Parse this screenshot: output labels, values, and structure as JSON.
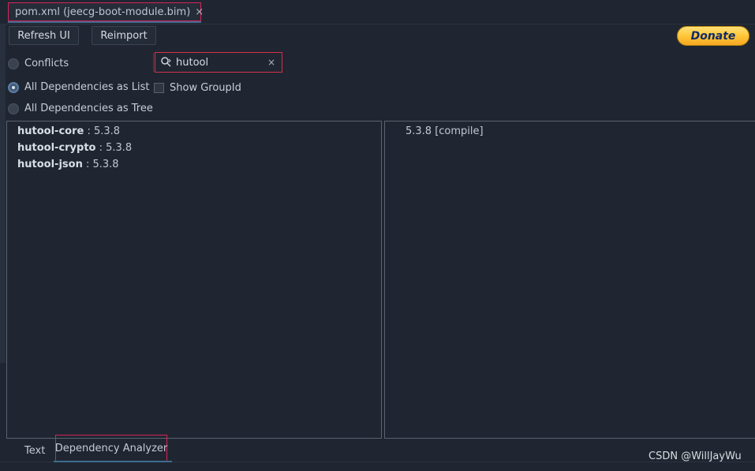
{
  "editor_tab": {
    "file_label": "pom.xml (jeecg-boot-module.bim)",
    "close_glyph": "×",
    "icon": "maven-icon"
  },
  "toolbar": {
    "refresh_label": "Refresh UI",
    "reimport_label": "Reimport",
    "donate_label": "Donate"
  },
  "view_mode": {
    "options": [
      {
        "label": "Conflicts",
        "selected": false
      },
      {
        "label": "All Dependencies as List",
        "selected": true
      },
      {
        "label": "All Dependencies as Tree",
        "selected": false
      }
    ],
    "show_group_id_label": "Show GroupId",
    "show_group_id_checked": false
  },
  "search": {
    "value": "hutool",
    "icon": "search-icon",
    "clear_glyph": "×"
  },
  "dependencies": [
    {
      "name": "hutool-core",
      "version": " : 5.3.8"
    },
    {
      "name": "hutool-crypto",
      "version": " : 5.3.8"
    },
    {
      "name": "hutool-json",
      "version": " : 5.3.8"
    }
  ],
  "details": {
    "version_scope": "5.3.8 [compile]"
  },
  "bottom_tabs": {
    "text_label": "Text",
    "analyzer_label": "Dependency Analyzer"
  },
  "watermark": "CSDN @WillJayWu",
  "colors": {
    "background": "#1f2631",
    "highlight_border": "#d6245a",
    "donate_gold": "#ffc93c",
    "tab_underline": "#3e6b8f"
  }
}
